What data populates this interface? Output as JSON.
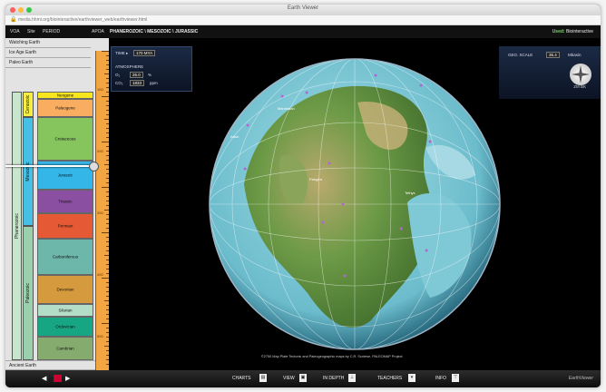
{
  "window": {
    "title": "Earth Viewer",
    "url": "media.hhmi.org/biointeractive/earthviewer_web/earthviewer.html"
  },
  "menu": {
    "items": [
      "VOA",
      "Site",
      "PERIOD",
      "APOA"
    ],
    "breadcrumb": "PHANEROZOIC \\ MESOZOIC \\ JURASSIC",
    "user_prefix": "Used:",
    "user_name": "Biointeractive"
  },
  "sidebar": {
    "items": [
      "Watching Earth",
      "Ice Age Earth",
      "Paleo Earth"
    ],
    "bottom_item": "Ancient Earth",
    "eon": "Phanerozoic",
    "eras": [
      {
        "name": "Cenozoic",
        "color": "#f7ee45"
      },
      {
        "name": "Mesozoic",
        "color": "#46c0e4"
      },
      {
        "name": "Paleozoic",
        "color": "#9bd0ad"
      }
    ],
    "periods": [
      {
        "name": "Neogene",
        "color": "#f7e51e"
      },
      {
        "name": "Paleogene",
        "color": "#f8ad61"
      },
      {
        "name": "Cretaceous",
        "color": "#86c45d"
      },
      {
        "name": "Jurassic",
        "color": "#34b6e8"
      },
      {
        "name": "Triassic",
        "color": "#8a4fa0"
      },
      {
        "name": "Permian",
        "color": "#e55a35"
      },
      {
        "name": "Carboniferous",
        "color": "#6db6aa"
      },
      {
        "name": "Devonian",
        "color": "#d59a3d"
      },
      {
        "name": "Silurian",
        "color": "#b3ddc6"
      },
      {
        "name": "Ordovician",
        "color": "#17a683"
      },
      {
        "name": "Cambrian",
        "color": "#86ab6e"
      }
    ]
  },
  "ruler": {
    "ticks": [
      "100",
      "200",
      "300",
      "400",
      "500"
    ]
  },
  "info": {
    "time_label": "TIME ▸",
    "time_value": "170 MYA",
    "atmosphere_label": "ATMOSPHERE",
    "o2_label": "O₂",
    "o2_value": "26.0",
    "o2_unit": "%",
    "co2_label": "CO₂",
    "co2_value": "1833",
    "co2_unit": "ppm"
  },
  "navpanel": {
    "label": "GEO. SCALE",
    "value": "35.4",
    "unit": "Mbasin",
    "zoom": "ZM BK"
  },
  "globe": {
    "labels": [
      "Manitoban",
      "Pangea",
      "Atlan",
      "Tethys"
    ]
  },
  "credit": "©2750 Map Plate Tectonic and Paleogeographic maps by C.R. Scotese, PALEOMAP Project",
  "bottom": {
    "items": [
      "CHARTS",
      "VIEW",
      "IN DEPTH",
      "TEACHERS",
      "INFO"
    ],
    "brand": "EarthViewer",
    "prev": "◀",
    "next": "▶"
  },
  "colors": {
    "accent": "#f3a541",
    "panel": "#1b2a44",
    "ocean": "#7fc8d6"
  }
}
